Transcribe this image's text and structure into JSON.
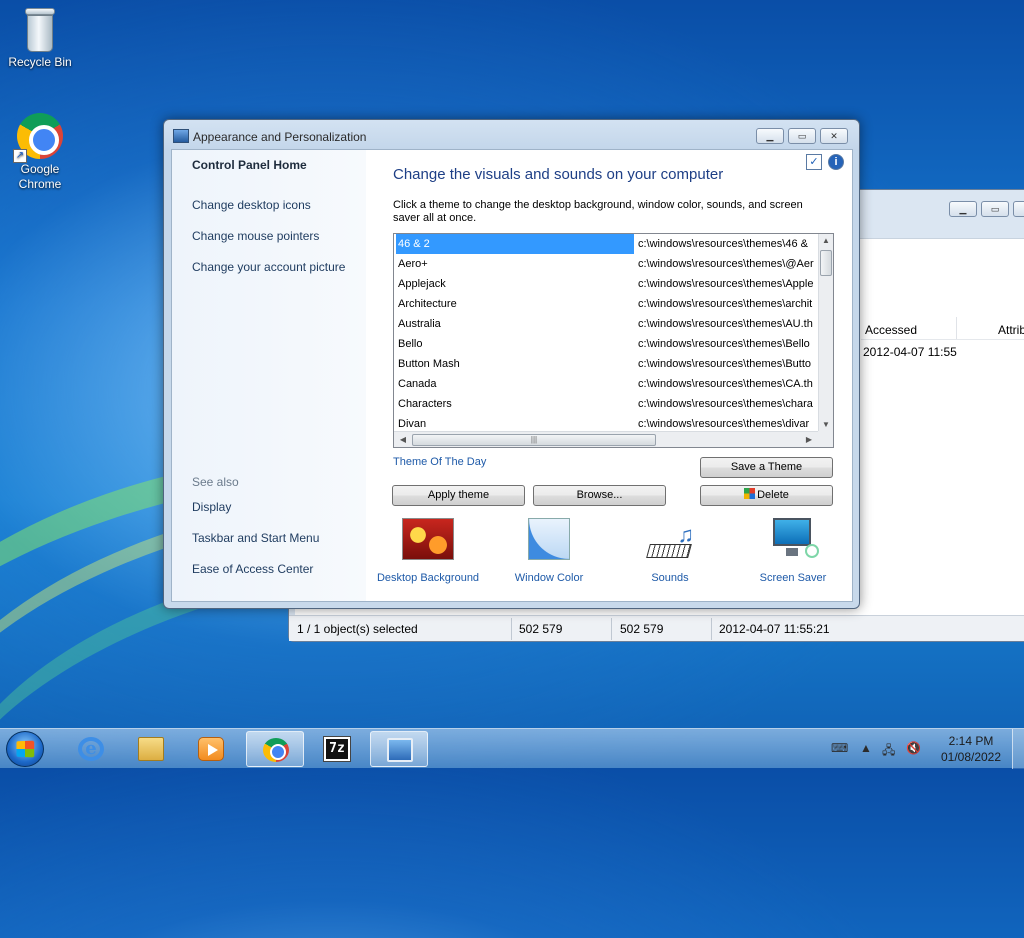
{
  "desktop": {
    "icons": [
      {
        "label": "Recycle Bin",
        "icon": "recycle-bin-icon"
      },
      {
        "label": "Google\nChrome",
        "icon": "chrome-icon"
      }
    ]
  },
  "back_window": {
    "columns": [
      "Accessed",
      "Attrib"
    ],
    "row_accessed": "2012-04-07 11:55",
    "status": [
      "1 / 1 object(s) selected",
      "502 579",
      "502 579",
      "2012-04-07 11:55:21"
    ],
    "controls": [
      "minimize",
      "maximize",
      "close"
    ]
  },
  "window": {
    "title": "Appearance and Personalization",
    "nav": {
      "home": "Control Panel Home",
      "links": [
        "Change desktop icons",
        "Change mouse pointers",
        "Change your account picture"
      ],
      "see_also_label": "See also",
      "see_also": [
        "Display",
        "Taskbar and Start Menu",
        "Ease of Access Center"
      ]
    },
    "content": {
      "heading": "Change the visuals and sounds on your computer",
      "description": "Click a theme to change the desktop background, window color, sounds, and screen saver all at once.",
      "themes": [
        {
          "name": "46 & 2",
          "path": "c:\\windows\\resources\\themes\\46 &"
        },
        {
          "name": "Aero+",
          "path": "c:\\windows\\resources\\themes\\@Aer"
        },
        {
          "name": "Applejack",
          "path": "c:\\windows\\resources\\themes\\Apple"
        },
        {
          "name": "Architecture",
          "path": "c:\\windows\\resources\\themes\\archit"
        },
        {
          "name": "Australia",
          "path": "c:\\windows\\resources\\themes\\AU.th"
        },
        {
          "name": "Bello",
          "path": "c:\\windows\\resources\\themes\\Bello"
        },
        {
          "name": "Button Mash",
          "path": "c:\\windows\\resources\\themes\\Butto"
        },
        {
          "name": "Canada",
          "path": "c:\\windows\\resources\\themes\\CA.th"
        },
        {
          "name": "Characters",
          "path": "c:\\windows\\resources\\themes\\chara"
        },
        {
          "name": "Divan",
          "path": "c:\\windows\\resources\\themes\\divar"
        }
      ],
      "selected_theme": "46 & 2",
      "theme_of_day": "Theme Of The Day",
      "buttons": {
        "save": "Save a Theme",
        "apply": "Apply theme",
        "browse": "Browse...",
        "delete": "Delete"
      },
      "tiles": [
        {
          "label": "Desktop Background",
          "icon": "desktop-background-icon"
        },
        {
          "label": "Window Color",
          "icon": "window-color-icon"
        },
        {
          "label": "Sounds",
          "icon": "sounds-icon"
        },
        {
          "label": "Screen Saver",
          "icon": "screen-saver-icon"
        }
      ]
    }
  },
  "taskbar": {
    "apps": [
      "internet-explorer-icon",
      "windows-explorer-icon",
      "media-player-icon",
      "chrome-icon",
      "7zip-icon",
      "control-panel-icon"
    ],
    "active_app": "chrome-icon",
    "tray_icons": [
      "keyboard-icon",
      "tray-arrow-icon",
      "network-icon",
      "volume-muted-icon"
    ],
    "time": "2:14 PM",
    "date": "01/08/2022"
  },
  "colors": {
    "accent": "#1e5aa8",
    "selection": "#3399ff",
    "heading": "#1e3f86"
  }
}
